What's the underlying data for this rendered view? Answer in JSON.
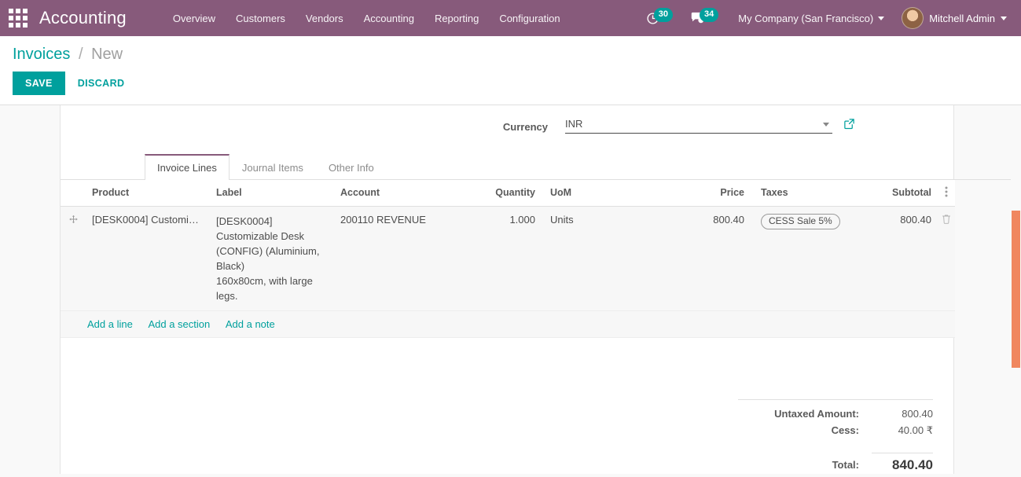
{
  "navbar": {
    "apps_icon": "apps-grid-icon",
    "brand": "Accounting",
    "menus": [
      {
        "label": "Overview"
      },
      {
        "label": "Customers"
      },
      {
        "label": "Vendors"
      },
      {
        "label": "Accounting"
      },
      {
        "label": "Reporting"
      },
      {
        "label": "Configuration"
      }
    ],
    "activities": {
      "icon": "clock-icon",
      "count": "30"
    },
    "messages": {
      "icon": "chat-bubble-icon",
      "count": "34"
    },
    "company": "My Company (San Francisco)",
    "user": "Mitchell Admin"
  },
  "control_panel": {
    "breadcrumb_root": "Invoices",
    "breadcrumb_sep": "/",
    "breadcrumb_current": "New",
    "save_label": "SAVE",
    "discard_label": "DISCARD"
  },
  "form": {
    "currency": {
      "label": "Currency",
      "value": "INR",
      "placeholder": "",
      "external_icon": "external-link-icon",
      "caret_icon": "chevron-down-icon"
    }
  },
  "tabs": [
    {
      "label": "Invoice Lines",
      "active": true
    },
    {
      "label": "Journal Items",
      "active": false
    },
    {
      "label": "Other Info",
      "active": false
    }
  ],
  "lines_table": {
    "columns": {
      "product": "Product",
      "label": "Label",
      "account": "Account",
      "quantity": "Quantity",
      "uom": "UoM",
      "price": "Price",
      "taxes": "Taxes",
      "subtotal": "Subtotal",
      "options_icon": "vertical-ellipsis-icon"
    },
    "rows": [
      {
        "handle_icon": "drag-handle-icon",
        "product": "[DESK0004] Customiza...",
        "label": "[DESK0004] Customizable Desk (CONFIG) (Aluminium, Black)\n160x80cm, with large legs.",
        "account": "200110 REVENUE",
        "quantity": "1.000",
        "uom": "Units",
        "price": "800.40",
        "tax": "CESS Sale 5%",
        "subtotal": "800.40",
        "delete_icon": "trash-icon"
      }
    ],
    "add_line": "Add a line",
    "add_section": "Add a section",
    "add_note": "Add a note"
  },
  "totals": {
    "untaxed_label": "Untaxed Amount:",
    "untaxed_value": "800.40",
    "cess_label": "Cess:",
    "cess_value": "40.00 ₹",
    "total_label": "Total:",
    "total_value": "840.40"
  },
  "colors": {
    "navbar": "#875a7b",
    "accent": "#00a09d",
    "scrollbar": "#f0875f",
    "tab_active_border": "#875a7b"
  }
}
